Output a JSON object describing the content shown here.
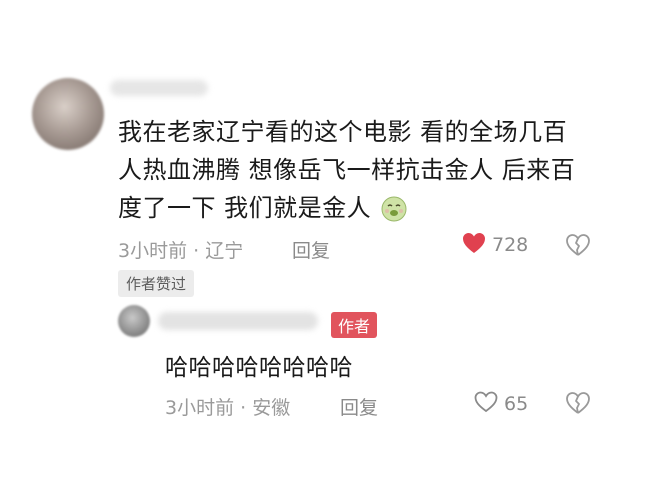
{
  "comment": {
    "text_line1": "我在老家辽宁看的这个电影 看的全场几百",
    "text_line2": "人热血沸腾 想像岳飞一样抗击金人 后来百",
    "text_line3": "度了一下 我们就是金人",
    "emoji": "nauseated-face-emoji",
    "time_location": "3小时前 · 辽宁",
    "reply_label": "回复",
    "like_count": "728",
    "liked": true,
    "author_liked_badge": "作者赞过"
  },
  "reply": {
    "author_tag": "作者",
    "text": "哈哈哈哈哈哈哈哈",
    "time_location": "3小时前 · 安徽",
    "reply_label": "回复",
    "like_count": "65",
    "liked": false
  },
  "colors": {
    "like_red": "#e0414f",
    "author_tag_bg": "#e1545d",
    "meta_gray": "#9a9a9a"
  }
}
